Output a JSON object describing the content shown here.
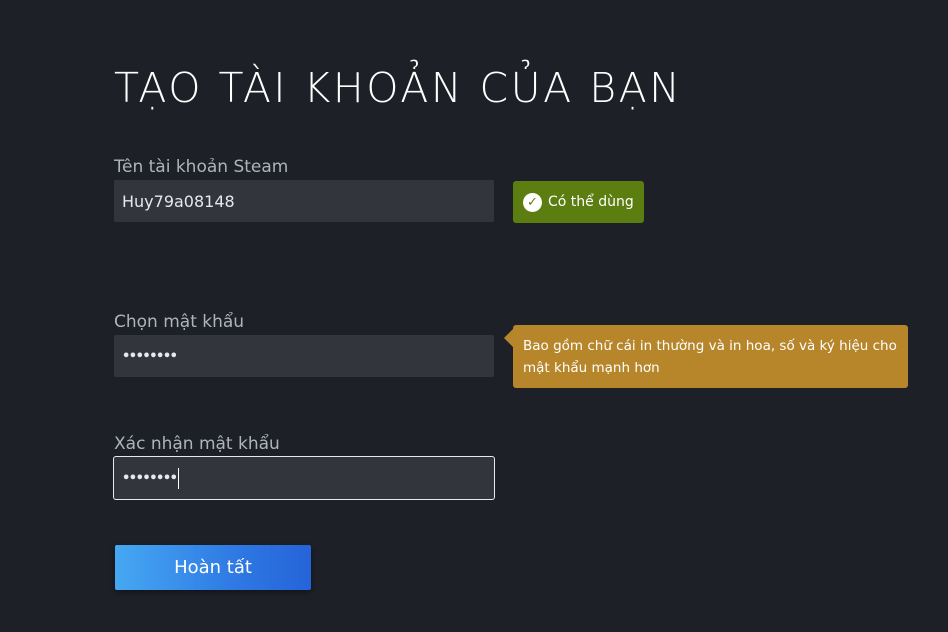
{
  "page": {
    "title": "TẠO TÀI KHOẢN CỦA BẠN"
  },
  "account_name": {
    "label": "Tên tài khoản Steam",
    "value": "Huy79a08148",
    "status_badge": {
      "text": "Có thể dùng",
      "icon": "check-circle-icon",
      "color": "#5c7e10"
    }
  },
  "password": {
    "label": "Chọn mật khẩu",
    "value": "••••••••",
    "hint": "Bao gồm chữ cái in thường và in hoa, số và ký hiệu cho mật khẩu mạnh hơn",
    "hint_color": "#b7852a"
  },
  "confirm_password": {
    "label": "Xác nhận mật khẩu",
    "value": "••••••••",
    "focused": true
  },
  "submit": {
    "label": "Hoàn tất",
    "color": "#3b8fec"
  }
}
